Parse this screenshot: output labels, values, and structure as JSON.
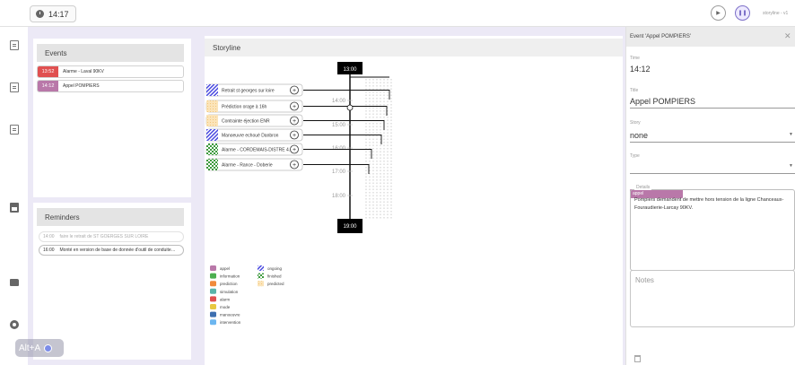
{
  "clock": "14:17",
  "version": "storyline - v1",
  "events_panel": {
    "title": "Events",
    "items": [
      {
        "time": "13:52",
        "title": "Alarme - Laval 90KV",
        "color": "#e05050"
      },
      {
        "time": "14:12",
        "title": "Appel POMPIERS",
        "color": "#b978a9"
      }
    ]
  },
  "reminders_panel": {
    "title": "Reminders",
    "items": [
      {
        "time": "14:00",
        "text": "faire le retrait de ST GOERGES SUR LOIRE",
        "muted": true
      },
      {
        "time": "16:00",
        "text": "Monté en version de base de donnée d'outil de conduite…",
        "muted": false
      }
    ]
  },
  "storyline": {
    "title": "Storyline",
    "start_label": "13:00",
    "end_label": "19:00",
    "hour_ticks": [
      "14:00",
      "15:00",
      "16:00",
      "17:00",
      "18:00"
    ],
    "stories": [
      {
        "label": "Retrait st georges sur loire",
        "pattern": "ongoing"
      },
      {
        "label": "Prédiction orage à 16h",
        "pattern": "predicted"
      },
      {
        "label": "Contrainte éjection ENR",
        "pattern": "predicted"
      },
      {
        "label": "Manoeuvre echoué Danbron",
        "pattern": "ongoing"
      },
      {
        "label": "Alarme - CORDEMAIS-DISTRE 4…",
        "pattern": "finished"
      },
      {
        "label": "Alarme - Rance - Doberie",
        "pattern": "finished"
      }
    ],
    "legend_types": [
      {
        "name": "appel",
        "color": "#b978a9"
      },
      {
        "name": "information",
        "color": "#4caf50"
      },
      {
        "name": "prediction",
        "color": "#f08a3c"
      },
      {
        "name": "simulation",
        "color": "#5ab4aa"
      },
      {
        "name": "alarm",
        "color": "#e05050"
      },
      {
        "name": "mode",
        "color": "#e8c840"
      },
      {
        "name": "manoeuvre",
        "color": "#3d6fb0"
      },
      {
        "name": "intervention",
        "color": "#6cb6f0"
      }
    ],
    "legend_status": [
      "ongoing",
      "finished",
      "predicted"
    ]
  },
  "detail": {
    "header": "Event 'Appel POMPIERS'",
    "time_label": "Time",
    "time_value": "14:12",
    "title_label": "Title",
    "title_value": "Appel POMPIERS",
    "story_label": "Story",
    "story_value": "none",
    "type_label": "Type",
    "type_value": "appel",
    "details_label": "Details",
    "details_value": "Pompiers demandent de mettre hors tension de la ligne Chanceaux-Fouraudierie-Larcay 90KV.",
    "notes_label": "Notes"
  },
  "alt_shortcut": "Alt+A",
  "colors": {
    "accent": "#7d70c8",
    "appel": "#b978a9",
    "alarm": "#e05050"
  }
}
